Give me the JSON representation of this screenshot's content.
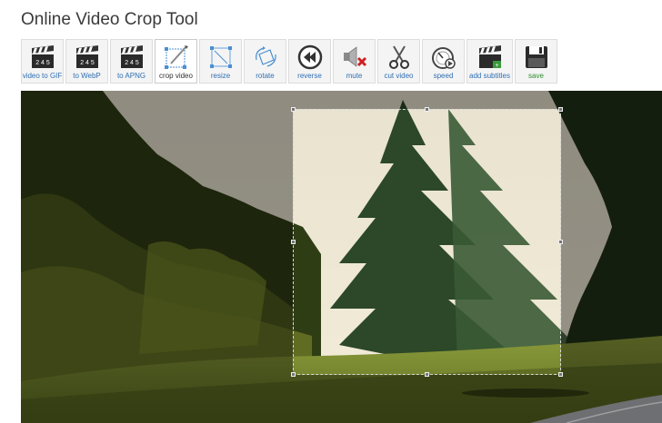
{
  "page": {
    "title": "Online Video Crop Tool"
  },
  "toolbar": {
    "tools": [
      {
        "label": "video to GIF",
        "icon": "clapperboard-icon"
      },
      {
        "label": "to WebP",
        "icon": "clapperboard-icon"
      },
      {
        "label": "to APNG",
        "icon": "clapperboard-icon"
      },
      {
        "label": "crop video",
        "icon": "crop-icon",
        "active": true
      },
      {
        "label": "resize",
        "icon": "resize-icon"
      },
      {
        "label": "rotate",
        "icon": "rotate-icon"
      },
      {
        "label": "reverse",
        "icon": "reverse-icon"
      },
      {
        "label": "mute",
        "icon": "mute-icon"
      },
      {
        "label": "cut video",
        "icon": "scissors-icon"
      },
      {
        "label": "speed",
        "icon": "speed-icon"
      },
      {
        "label": "add subtitles",
        "icon": "clapperboard-icon"
      },
      {
        "label": "save",
        "icon": "floppy-disk-icon"
      }
    ]
  },
  "colors": {
    "label_blue": "#2f6fb3",
    "save_green": "#2e8b2e",
    "crop_border": "#d6d6d6"
  }
}
